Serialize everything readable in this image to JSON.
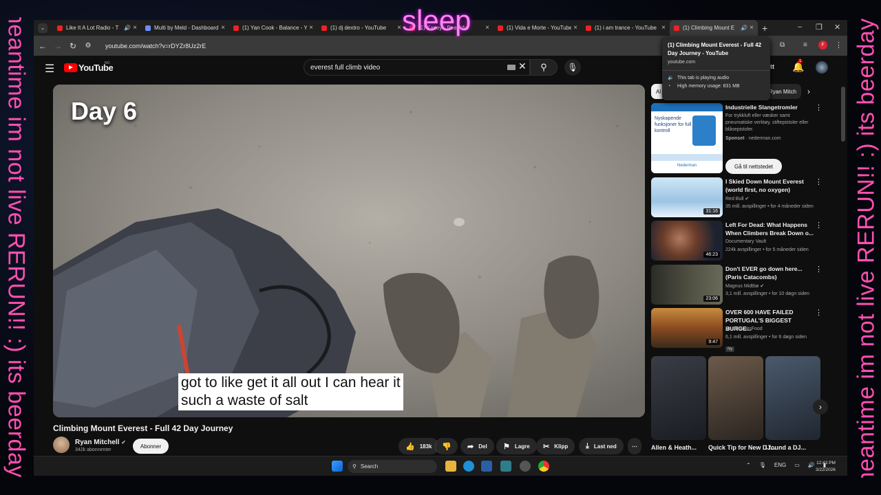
{
  "overlay": {
    "left_text": "meantime im not live RERUN!! :) its beerday!!",
    "right_text": "meantime im not live RERUN!! :) its beerday!!",
    "top_text": "sleep"
  },
  "browser": {
    "tabs": [
      {
        "label": "Like It A Lot Radio - T"
      },
      {
        "label": "Multi by Meld - Dashboard"
      },
      {
        "label": "(1) Yan Cook - Balance - Y"
      },
      {
        "label": "(1) dj dextro - YouTube"
      },
      {
        "label": "(1) Kacey - Peaceful"
      },
      {
        "label": "(1) Vida e Morte - YouTube"
      },
      {
        "label": "(1) i am trance - YouTube"
      },
      {
        "label": "(1) Climbing Mount E"
      }
    ],
    "url": "youtube.com/watch?v=rDYZr8Uz2rE"
  },
  "tooltip": {
    "title": "(1) Climbing Mount Everest - Full 42\nDay Journey - YouTube",
    "domain": "youtube.com",
    "audio": "This tab is playing audio",
    "memory": "High memory usage: 831 MB"
  },
  "youtube": {
    "logo": "YouTube",
    "region": "NO",
    "search_value": "everest full climb video",
    "create_label": "ett",
    "notification_count": "1"
  },
  "video": {
    "overlay_title": "Day 6",
    "caption_line1": "got to like get it all out I can hear it",
    "caption_line2": "such a waste of salt",
    "title": "Climbing Mount Everest - Full 42 Day Journey",
    "channel": "Ryan Mitchell",
    "subscribers": "342k abonnenter",
    "subscribe": "Abonner",
    "likes": "183k",
    "share": "Del",
    "save": "Lagre",
    "clip": "Klipp",
    "download": "Last ned"
  },
  "chips": [
    {
      "label": "Al"
    },
    {
      "label": "Ryan Mitch"
    }
  ],
  "ad": {
    "title": "Industrielle Slangetromler",
    "description": "For trykkluft eller væsker samt pneumatiske verktøy, stiftepistoler eller blåsepistoler.",
    "sponsored": "Sponset",
    "domain": "nederman.com",
    "cta": "Gå til nettstedet",
    "thumb_text": "Nyskapende funksjoner for full kontroll",
    "brand": "Nederman"
  },
  "recommendations": [
    {
      "title": "I Skied Down Mount Everest (world first, no oxygen)",
      "channel": "Red Bull",
      "meta": "35 mill. avspillinger • for 4 måneder siden",
      "duration": "31:16"
    },
    {
      "title": "Left For Dead: What Happens When Climbers Break Down o...",
      "channel": "Documentary Vault",
      "meta": "224k avspillinger • for 5 måneder siden",
      "duration": "46:23"
    },
    {
      "title": "Don't EVER go down here... (Paris Catacombs)",
      "channel": "Magnus Midtbø",
      "meta": "3,1 mill. avspillinger • for 10 døgn siden",
      "duration": "23:06"
    },
    {
      "title": "OVER 600 HAVE FAILED PORTUGAL'S BIGGEST BURGE...",
      "channel": "BeardMeatsFood",
      "meta": "6,1 mill. avspillinger • for 6 døgn siden",
      "duration": "9:47",
      "badge": "Ny"
    }
  ],
  "shorts": [
    {
      "title": "Allen & Heath..."
    },
    {
      "title": "Quick Tip for New DJ..."
    },
    {
      "title": "I found a DJ..."
    }
  ],
  "taskbar": {
    "search": "Search",
    "lang": "ENG",
    "time": "12:43 PM",
    "date": "3/22/2026"
  }
}
